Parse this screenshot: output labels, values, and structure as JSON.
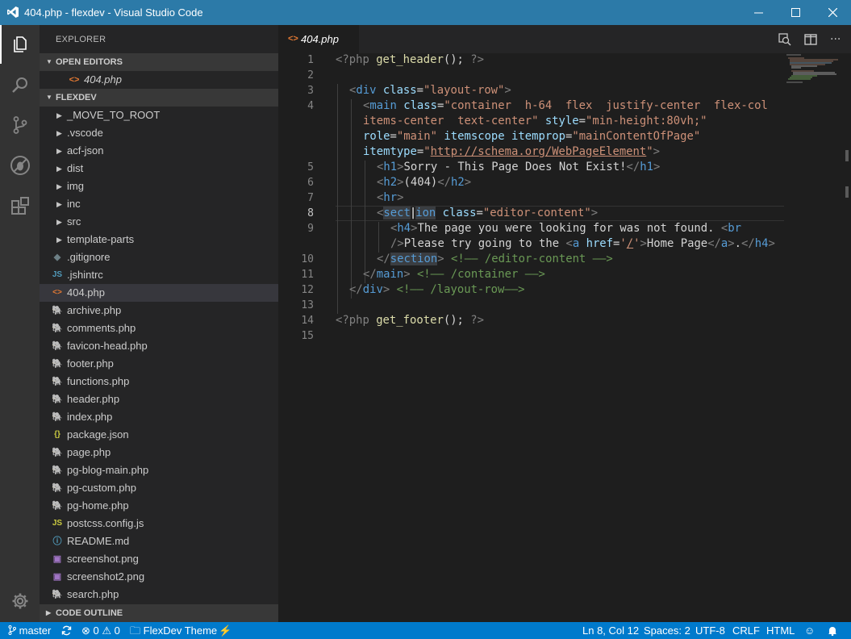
{
  "window": {
    "title": "404.php - flexdev - Visual Studio Code"
  },
  "sidebar": {
    "explorer_title": "EXPLORER",
    "open_editors_title": "OPEN EDITORS",
    "open_editors": [
      {
        "label": "404.php"
      }
    ],
    "project_title": "FLEXDEV",
    "code_outline_title": "CODE OUTLINE",
    "folders": [
      {
        "label": "_MOVE_TO_ROOT"
      },
      {
        "label": ".vscode"
      },
      {
        "label": "acf-json"
      },
      {
        "label": "dist"
      },
      {
        "label": "img"
      },
      {
        "label": "inc"
      },
      {
        "label": "src"
      },
      {
        "label": "template-parts"
      }
    ],
    "files": [
      {
        "label": ".gitignore",
        "icon": "gitignore-icon",
        "glyph": "◆",
        "color": "#6d8086"
      },
      {
        "label": ".jshintrc",
        "icon": "js-icon",
        "glyph": "JS",
        "color": "#519aba"
      },
      {
        "label": "404.php",
        "icon": "html-php-icon",
        "glyph": "<>",
        "color": "#e37933"
      },
      {
        "label": "archive.php",
        "icon": "php-elephant-icon",
        "glyph": "🐘",
        "color": "#a074c4"
      },
      {
        "label": "comments.php",
        "icon": "php-elephant-icon",
        "glyph": "🐘",
        "color": "#a074c4"
      },
      {
        "label": "favicon-head.php",
        "icon": "php-elephant-icon",
        "glyph": "🐘",
        "color": "#a074c4"
      },
      {
        "label": "footer.php",
        "icon": "php-elephant-icon",
        "glyph": "🐘",
        "color": "#a074c4"
      },
      {
        "label": "functions.php",
        "icon": "php-elephant-icon",
        "glyph": "🐘",
        "color": "#a074c4"
      },
      {
        "label": "header.php",
        "icon": "php-elephant-icon",
        "glyph": "🐘",
        "color": "#a074c4"
      },
      {
        "label": "index.php",
        "icon": "php-elephant-icon",
        "glyph": "🐘",
        "color": "#a074c4"
      },
      {
        "label": "package.json",
        "icon": "json-icon",
        "glyph": "{}",
        "color": "#cbcb41"
      },
      {
        "label": "page.php",
        "icon": "php-elephant-icon",
        "glyph": "🐘",
        "color": "#a074c4"
      },
      {
        "label": "pg-blog-main.php",
        "icon": "php-elephant-icon",
        "glyph": "🐘",
        "color": "#a074c4"
      },
      {
        "label": "pg-custom.php",
        "icon": "php-elephant-icon",
        "glyph": "🐘",
        "color": "#a074c4"
      },
      {
        "label": "pg-home.php",
        "icon": "php-elephant-icon",
        "glyph": "🐘",
        "color": "#a074c4"
      },
      {
        "label": "postcss.config.js",
        "icon": "js-icon",
        "glyph": "JS",
        "color": "#cbcb41"
      },
      {
        "label": "README.md",
        "icon": "info-icon",
        "glyph": "ⓘ",
        "color": "#519aba"
      },
      {
        "label": "screenshot.png",
        "icon": "image-icon",
        "glyph": "▣",
        "color": "#a074c4"
      },
      {
        "label": "screenshot2.png",
        "icon": "image-icon",
        "glyph": "▣",
        "color": "#a074c4"
      },
      {
        "label": "search.php",
        "icon": "php-elephant-icon",
        "glyph": "🐘",
        "color": "#a074c4"
      }
    ],
    "selected_file": "404.php"
  },
  "editor": {
    "tab_label": "404.php",
    "line_numbers": [
      "1",
      "2",
      "3",
      "4",
      "5",
      "6",
      "7",
      "8",
      "9",
      "10",
      "11",
      "12",
      "13",
      "14",
      "15"
    ],
    "code": {
      "l1_open": "<?php ",
      "l1_fn": "get_header",
      "l1_rest": "(); ",
      "l1_close": "?>",
      "l3_tag": "div",
      "l3_attr": "class",
      "l3_val": "\"layout-row\"",
      "l4a_tag": "main",
      "l4a_attr": "class",
      "l4a_val": "\"container  h-64  flex  justify-center  flex-col",
      "l4b_val": "items-center  text-center\"",
      "l4b_attr": "style",
      "l4b_val2": "\"min-height:80vh;\"",
      "l4c_attr1": "role",
      "l4c_val1": "\"main\"",
      "l4c_attr2": "itemscope",
      "l4c_attr3": "itemprop",
      "l4c_val3": "\"mainContentOfPage\"",
      "l4d_attr": "itemtype",
      "l4d_q1": "\"",
      "l4d_url": "http://schema.org/WebPageElement",
      "l4d_q2": "\"",
      "l5_tag": "h1",
      "l5_text": "Sorry - This Page Does Not Exist!",
      "l6_tag": "h2",
      "l6_text": "(404)",
      "l7_tag": "hr",
      "l8_tag_a": "sect",
      "l8_tag_b": "ion",
      "l8_attr": "class",
      "l8_val": "\"editor-content\"",
      "l9a_tag": "h4",
      "l9a_text": "The page you were looking for was not found. ",
      "l9a_br": "br",
      "l9b_text": "Please try going to the ",
      "l9b_tag": "a",
      "l9b_attr": "href",
      "l9b_q1": "'",
      "l9b_url": "/",
      "l9b_q2": "'",
      "l9b_link": "Home Page",
      "l9b_dot": ".",
      "l10_tag": "section",
      "l10_comment": "<!—— /editor-content ——>",
      "l11_tag": "main",
      "l11_comment": "<!—— /container ——>",
      "l12_tag": "div",
      "l12_comment": "<!—— /layout-row——>",
      "l14_open": "<?php ",
      "l14_fn": "get_footer",
      "l14_rest": "(); ",
      "l14_close": "?>"
    }
  },
  "statusbar": {
    "branch": "master",
    "errors": "0",
    "warnings": "0",
    "folder": "FlexDev Theme",
    "cursor": "Ln 8, Col 12",
    "spaces": "Spaces: 2",
    "encoding": "UTF-8",
    "eol": "CRLF",
    "language": "HTML"
  }
}
